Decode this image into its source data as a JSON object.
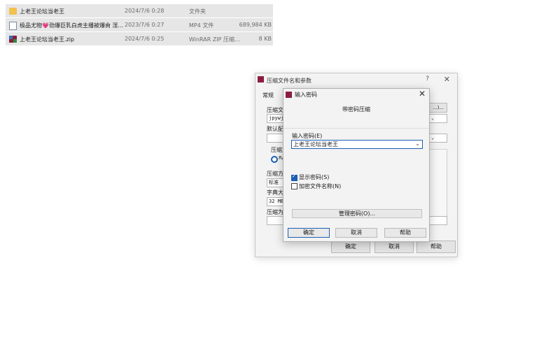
{
  "files": [
    {
      "name": "上老王论坛当老王",
      "date": "2024/7/6 0:28",
      "type": "文件夹",
      "size": "",
      "icon": "folder-icon"
    },
    {
      "name": "极品尤物💗劲爆巨乳白虎主播被爆肏 淫...",
      "date": "2023/7/6 0:27",
      "type": "MP4 文件",
      "size": "689,984 KB",
      "icon": "video-file-icon"
    },
    {
      "name": "上老王论坛当老王.zip",
      "date": "2024/7/6 0:25",
      "type": "WinRAR ZIP 压缩...",
      "size": "8 KB",
      "icon": "winrar-archive-icon"
    }
  ],
  "archive_dialog": {
    "title": "压缩文件名和参数",
    "help": "?",
    "close": "✕",
    "tab": "常规",
    "archive_name_label": "压缩文",
    "archive_name_value": "jpywjl",
    "browse_button": "...)...",
    "default_profile_label": "默认配",
    "format_label": "压缩文",
    "format_radio": "RA",
    "method_label": "压缩方",
    "method_value": "标准",
    "dict_label": "字典大",
    "dict_value": "32 MB",
    "split_label": "压缩为",
    "ok": "确定",
    "cancel": "取消",
    "help_button": "帮助"
  },
  "password_dialog": {
    "title": "输入密码",
    "close": "✕",
    "header": "带密码压缩",
    "password_label": "输入密码(E)",
    "password_value": "上老王论坛当老王",
    "show_password_label": "显示密码(S)",
    "show_password_checked": true,
    "encrypt_names_label": "加密文件名称(N)",
    "encrypt_names_checked": false,
    "manage_button": "管理密码(O)...",
    "ok": "确定",
    "cancel": "取消",
    "help_button": "帮助"
  }
}
